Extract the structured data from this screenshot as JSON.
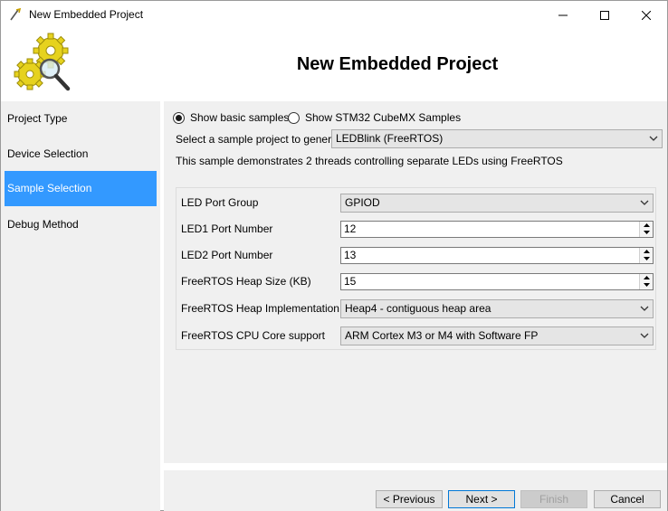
{
  "window": {
    "title": "New Embedded Project",
    "controls": {
      "minimize": "minimize-icon",
      "maximize": "maximize-icon",
      "close": "close-icon"
    }
  },
  "header": {
    "heading": "New Embedded Project",
    "logo": "gears-magnifier-logo"
  },
  "sidebar": {
    "steps": [
      {
        "label": "Project Type",
        "active": false
      },
      {
        "label": "Device Selection",
        "active": false
      },
      {
        "label": "Sample Selection",
        "active": true
      },
      {
        "label": "Debug Method",
        "active": false
      }
    ],
    "active_color": "#3399ff"
  },
  "samples": {
    "radio_basic": "Show basic samples",
    "radio_cubemx": "Show STM32 CubeMX Samples",
    "selected": "Show basic samples",
    "select_label": "Select a sample project to generate:",
    "selected_project": "LEDBlink (FreeRTOS)",
    "description": "This sample demonstrates 2 threads controlling separate LEDs using FreeRTOS"
  },
  "params": [
    {
      "label": "LED Port Group",
      "value": "GPIOD",
      "control": "combo"
    },
    {
      "label": "LED1 Port Number",
      "value": "12",
      "control": "spin"
    },
    {
      "label": "LED2 Port Number",
      "value": "13",
      "control": "spin"
    },
    {
      "label": "FreeRTOS Heap Size (KB)",
      "value": "15",
      "control": "spin"
    },
    {
      "label": "FreeRTOS Heap Implementation",
      "value": "Heap4 - contiguous heap area",
      "control": "combo"
    },
    {
      "label": "FreeRTOS CPU Core support",
      "value": "ARM Cortex M3 or M4 with Software FP",
      "control": "combo"
    }
  ],
  "buttons": {
    "previous": "< Previous",
    "next": "Next >",
    "finish": "Finish",
    "cancel": "Cancel"
  }
}
